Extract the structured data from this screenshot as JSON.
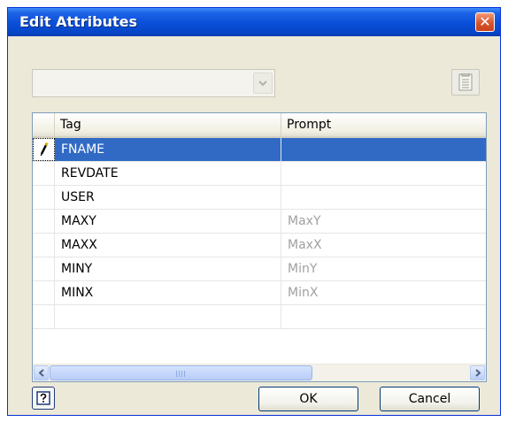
{
  "window": {
    "title": "Edit Attributes"
  },
  "grid": {
    "columns": [
      "Tag",
      "Prompt"
    ],
    "rows": [
      {
        "tag": "FNAME",
        "prompt": "",
        "selected": true
      },
      {
        "tag": "REVDATE",
        "prompt": ""
      },
      {
        "tag": "USER",
        "prompt": ""
      },
      {
        "tag": "MAXY",
        "prompt": "MaxY"
      },
      {
        "tag": "MAXX",
        "prompt": "MaxX"
      },
      {
        "tag": "MINY",
        "prompt": "MinY"
      },
      {
        "tag": "MINX",
        "prompt": "MinX"
      },
      {
        "tag": "",
        "prompt": ""
      }
    ]
  },
  "buttons": {
    "ok": "OK",
    "cancel": "Cancel"
  },
  "icons": {
    "close": "close-icon",
    "combo_arrow": "chevron-down-icon",
    "list": "list-icon",
    "pencil": "pencil-icon",
    "help": "help-icon"
  },
  "colors": {
    "titlebar": "#0a4fd9",
    "selection": "#316ac5",
    "dialog": "#ece9d8"
  }
}
